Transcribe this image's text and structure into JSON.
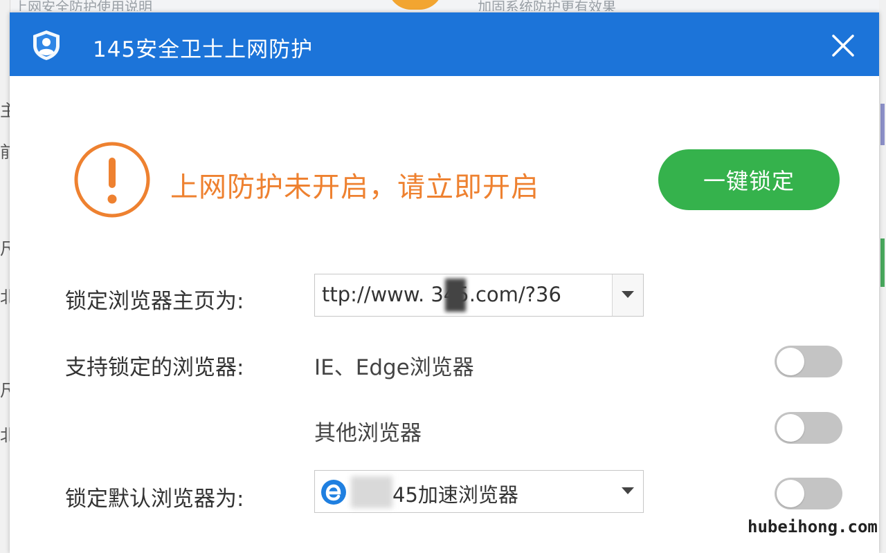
{
  "background": {
    "text_left": "上网安全防护使用说明",
    "text_right": "加固系统防护更有效果",
    "left_chars": [
      "主",
      "前",
      "尺",
      "北",
      "尺",
      "北"
    ]
  },
  "dialog": {
    "title": "145安全卫士上网防护",
    "title_color": "#1c74d9",
    "warning_text": "上网防护未开启，请立即开启",
    "warning_color": "#ee8130",
    "lock_button_label": "一键锁定",
    "lock_button_color": "#35b24c"
  },
  "settings": {
    "homepage_label": "锁定浏览器主页为:",
    "homepage_value": "ttp://www.  345.com/?36",
    "supported_label": "支持锁定的浏览器:",
    "browsers": [
      {
        "name": "IE、Edge浏览器",
        "enabled": false
      },
      {
        "name": "其他浏览器",
        "enabled": false
      }
    ],
    "default_label": "锁定默认浏览器为:",
    "default_value": "45加速浏览器",
    "default_enabled": false
  },
  "watermark": "hubeihong.com"
}
